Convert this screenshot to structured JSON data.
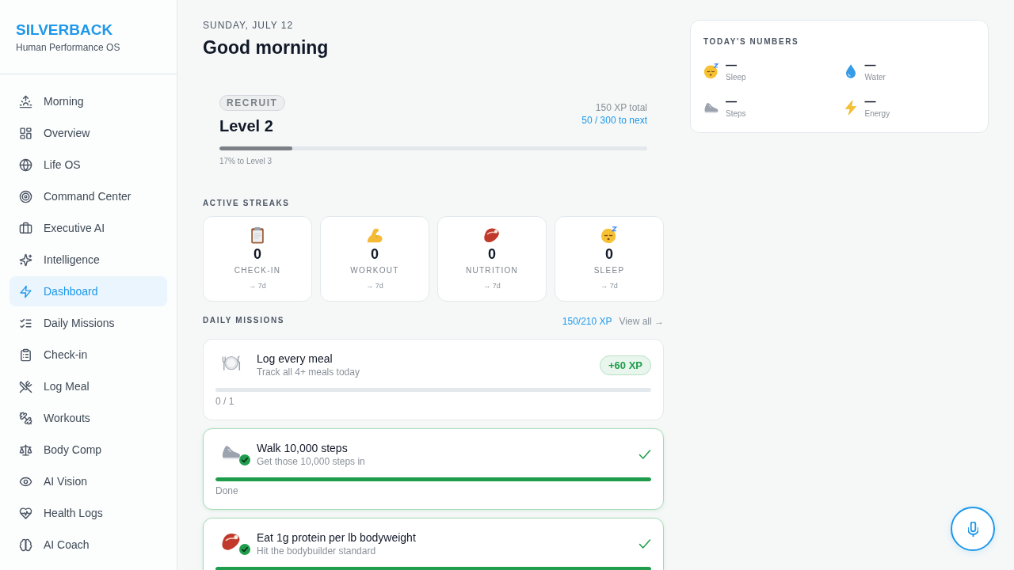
{
  "sidebar": {
    "brand": "SILVERBACK",
    "tagline": "Human Performance OS",
    "items": [
      {
        "label": "Morning",
        "selected": false
      },
      {
        "label": "Overview",
        "selected": false
      },
      {
        "label": "Life OS",
        "selected": false
      },
      {
        "label": "Command Center",
        "selected": false
      },
      {
        "label": "Executive AI",
        "selected": false
      },
      {
        "label": "Intelligence",
        "selected": false
      },
      {
        "label": "Dashboard",
        "selected": true
      },
      {
        "label": "Daily Missions",
        "selected": false
      },
      {
        "label": "Check-in",
        "selected": false
      },
      {
        "label": "Log Meal",
        "selected": false
      },
      {
        "label": "Workouts",
        "selected": false
      },
      {
        "label": "Body Comp",
        "selected": false
      },
      {
        "label": "AI Vision",
        "selected": false
      },
      {
        "label": "Health Logs",
        "selected": false
      },
      {
        "label": "AI Coach",
        "selected": false
      }
    ]
  },
  "header": {
    "date": "SUNDAY, JULY 12",
    "greeting": "Good morning"
  },
  "level_card": {
    "rank": "RECRUIT",
    "title": "Level 2",
    "total": "150 XP total",
    "to_next": "50 / 300 to next",
    "level": 0.17,
    "caption": "17% to Level 3"
  },
  "streaks": {
    "title": "ACTIVE STREAKS",
    "items": [
      {
        "count": "0",
        "label": "CHECK-IN",
        "goal": "→ 7d"
      },
      {
        "count": "0",
        "label": "WORKOUT",
        "goal": "→ 7d"
      },
      {
        "count": "0",
        "label": "NUTRITION",
        "goal": "→ 7d"
      },
      {
        "count": "0",
        "label": "SLEEP",
        "goal": "→ 7d"
      }
    ]
  },
  "missions": {
    "title": "DAILY MISSIONS",
    "xp": "150/210 XP",
    "link": "View all →",
    "items": [
      {
        "title": "Log every meal",
        "subtitle": "Track all 4+ meals today",
        "xp": "+60 XP",
        "done": false,
        "progress": "0 / 1"
      },
      {
        "title": "Walk 10,000 steps",
        "subtitle": "Get those 10,000 steps in",
        "done": true,
        "level": 1,
        "progress": "Done"
      },
      {
        "title": "Eat 1g protein per lb bodyweight",
        "subtitle": "Hit the bodybuilder standard",
        "done": true,
        "level": 1
      }
    ]
  },
  "todays_numbers": {
    "title": "TODAY'S NUMBERS",
    "items": [
      {
        "value": "—",
        "label": "Sleep"
      },
      {
        "value": "—",
        "label": "Water"
      },
      {
        "value": "—",
        "label": "Steps"
      },
      {
        "value": "—",
        "label": "Energy"
      }
    ]
  }
}
